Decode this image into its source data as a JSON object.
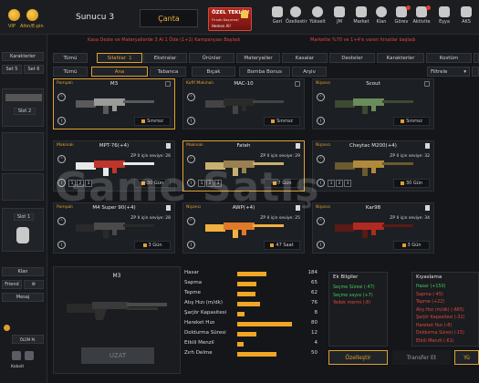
{
  "header": {
    "vip": "VIP",
    "altin": "Altın/E-pin",
    "server": "Sunucu 3",
    "bag_button": "Çanta",
    "offer": {
      "title": "ÖZEL TEKLİF!",
      "subtitle": "Fırsatı Kaçırma!",
      "cta": "Hemen Al!"
    },
    "nav": [
      {
        "label": "Geri",
        "icon": "back-icon"
      },
      {
        "label": "Özellestir",
        "icon": "customize-icon"
      },
      {
        "label": "Yükselt",
        "icon": "upgrade-icon"
      },
      {
        "label": "JM",
        "icon": "jm-icon"
      },
      {
        "label": "Market",
        "icon": "market-icon"
      },
      {
        "label": "Klan",
        "icon": "clan-icon"
      },
      {
        "label": "Görev",
        "icon": "mission-icon"
      },
      {
        "label": "Aktivite",
        "icon": "activity-icon"
      },
      {
        "label": "Eşya",
        "icon": "items-icon"
      },
      {
        "label": "AKS",
        "icon": "aks-icon"
      }
    ]
  },
  "announcements": {
    "left": "Kasa Deste ve Materyallerde 3 Al 1 Öde (1+2) Kampanyası Başladı",
    "right": "Markette %70 ve 1+4'e varan fırsatlar başladı"
  },
  "left_panel": {
    "tabs": [
      "Karakterler",
      "Set 5",
      "Set 6"
    ],
    "slot1": "Slot 2",
    "slot2": "Slot 1",
    "clan": "Klan",
    "friend": "Friend",
    "message": "Mesaj",
    "status": "ÖLÜM M.",
    "bottom": "Kobolt"
  },
  "tabs_row1": [
    {
      "label": "Tümü",
      "active": false
    },
    {
      "label": "Silahlar",
      "active": true,
      "count": "1"
    },
    {
      "label": "Ekstralar",
      "active": false
    },
    {
      "label": "Ürünler",
      "active": false
    },
    {
      "label": "Materyaller",
      "active": false
    },
    {
      "label": "Kasalar",
      "active": false
    },
    {
      "label": "Desteler",
      "active": false
    },
    {
      "label": "Karakterler",
      "active": false
    },
    {
      "label": "Kostüm",
      "active": false
    }
  ],
  "tabs_row2": [
    {
      "label": "Tümü",
      "active": false
    },
    {
      "label": "Ana",
      "active": true
    },
    {
      "label": "Tabanca",
      "active": false
    },
    {
      "label": "Bıçak",
      "active": false
    },
    {
      "label": "Bomba Bonus",
      "active": false
    },
    {
      "label": "Arşiv",
      "active": false
    }
  ],
  "filter": "Filtrele",
  "cards": [
    {
      "type": "Pompalı",
      "name": "M3",
      "duration": "Sınırsız",
      "selected": true,
      "level": "",
      "weapon": "shotgun-gray"
    },
    {
      "type": "Kofif Makinalı",
      "name": "MAC-10",
      "duration": "Sınırsız",
      "selected": false,
      "level": "",
      "weapon": "smg-black"
    },
    {
      "type": "Nişancı",
      "name": "Scout",
      "duration": "Sınırsız",
      "selected": false,
      "level": "",
      "weapon": "sniper-green"
    },
    {
      "type": "Makinalı",
      "name": "MPT-76(+4)",
      "duration": "30 Gün",
      "selected": false,
      "level": "ZP II için seviye: 26",
      "weapon": "rifle-red",
      "slots": [
        "1",
        "2",
        "3"
      ]
    },
    {
      "type": "Makinalı",
      "name": "Fateh",
      "duration": "7 Gün",
      "selected": true,
      "level": "ZP II için seviye: 29",
      "weapon": "rifle-camo",
      "slots": [
        "1",
        "2",
        "3"
      ]
    },
    {
      "type": "Nişancı",
      "name": "Cheytac M200(+4)",
      "duration": "30 Gün",
      "selected": false,
      "level": "ZP II için seviye: 32",
      "weapon": "sniper-gold",
      "slots": [
        "1",
        "2",
        "3"
      ]
    },
    {
      "type": "Pompalı",
      "name": "M4 Super 90(+4)",
      "duration": "3 Gün",
      "selected": false,
      "level": "ZP II için seviye: 28",
      "weapon": "shotgun-dark"
    },
    {
      "type": "Nişancı",
      "name": "AWP(+4)",
      "duration": "47 Saat",
      "selected": false,
      "level": "ZP II için seviye: 25",
      "weapon": "sniper-orange"
    },
    {
      "type": "Nişancı",
      "name": "Kar98",
      "duration": "3 Gün",
      "selected": false,
      "level": "ZP II için seviye: 34",
      "weapon": "sniper-red"
    }
  ],
  "detail": {
    "weapon_name": "M3",
    "button": "UZAT",
    "stats": [
      {
        "name": "Hasar",
        "value": 184,
        "pct": 0.45
      },
      {
        "name": "Sapma",
        "value": 65,
        "pct": 0.3
      },
      {
        "name": "Tepme",
        "value": 62,
        "pct": 0.29
      },
      {
        "name": "Atış Hızı (m/dk)",
        "value": 76,
        "pct": 0.35
      },
      {
        "name": "Şarjör Kapasitesi",
        "value": 8,
        "pct": 0.12
      },
      {
        "name": "Hareket Hızı",
        "value": 80,
        "pct": 0.85
      },
      {
        "name": "Doldurma Süresi",
        "value": 12,
        "pct": 0.3
      },
      {
        "name": "Etkili Menzil",
        "value": 4,
        "pct": 0.1
      },
      {
        "name": "Zırh Delme",
        "value": 50,
        "pct": 0.62
      }
    ]
  },
  "extra": {
    "title": "Ek Bilgiler",
    "lines": [
      {
        "text": "Seçme Süresi (-47)",
        "cls": "g"
      },
      {
        "text": "Seçme sayısı (+7)",
        "cls": "g"
      },
      {
        "text": "Yedek mermi (-8)",
        "cls": "r"
      }
    ]
  },
  "compare": {
    "title": "Kıyaslama",
    "lines": [
      {
        "text": "Hasar (+150)",
        "cls": "g"
      },
      {
        "text": "Sapma (-45)",
        "cls": "r"
      },
      {
        "text": "Tepme (+22)",
        "cls": "r"
      },
      {
        "text": "Atış Hızı (m/dk) (-665)",
        "cls": "r"
      },
      {
        "text": "Şarjör Kapasitesi (-32)",
        "cls": "r"
      },
      {
        "text": "Hareket Hızı (-8)",
        "cls": "r"
      },
      {
        "text": "Doldurma Süresi (-15)",
        "cls": "r"
      },
      {
        "text": "Etkili Menzil (-61)",
        "cls": "r"
      }
    ]
  },
  "bottom_buttons": {
    "customize": "Özelleştir",
    "transfer": "Transfer Et",
    "upgrade": "Yü"
  },
  "watermark": "Game Satış"
}
